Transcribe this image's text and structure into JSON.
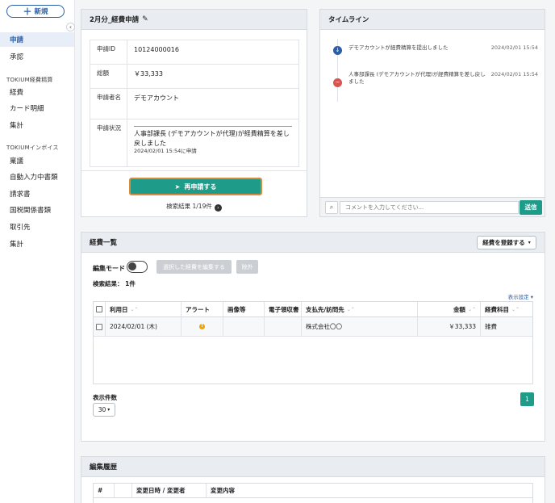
{
  "sidebar": {
    "new_button": "新規",
    "items_top": [
      {
        "label": "申請",
        "active": true
      },
      {
        "label": "承認",
        "active": false
      }
    ],
    "section_expense": "TOKIUM経費精算",
    "items_expense": [
      {
        "label": "経費"
      },
      {
        "label": "カード明細"
      },
      {
        "label": "集計"
      }
    ],
    "section_invoice": "TOKIUMインボイス",
    "items_invoice": [
      {
        "label": "稟議"
      },
      {
        "label": "自動入力中書類"
      },
      {
        "label": "請求書"
      },
      {
        "label": "国税関係書類"
      },
      {
        "label": "取引先"
      },
      {
        "label": "集計"
      }
    ]
  },
  "request": {
    "title": "2月分_経費申請",
    "fields": [
      {
        "key": "申請ID",
        "value": "10124000016"
      },
      {
        "key": "総額",
        "value": "￥33,333"
      },
      {
        "key": "申請者名",
        "value": "デモアカウント"
      },
      {
        "key": "申請状況",
        "value": "人事部課長 (デモアカウントが代理)が経費精算を差し戻しました",
        "sub": "2024/02/01 15:54に申請"
      }
    ],
    "resubmit_label": "再申請する",
    "search_result": "検索結果 1/19件"
  },
  "timeline": {
    "title": "タイムライン",
    "events": [
      {
        "text": "デモアカウントが経費精算を提出しました",
        "time": "2024/02/01 15:54",
        "icon": "down-arrow-icon",
        "color": "#2a5fab"
      },
      {
        "text": "人事部課長 (デモアカウントが代理)が経費精算を差し戻しました",
        "time": "2024/02/01 15:54",
        "icon": "minus-icon",
        "color": "#d9534f"
      }
    ],
    "comment_placeholder": "コメントを入力してください...",
    "send_label": "送信"
  },
  "expenses": {
    "title": "経費一覧",
    "register_label": "経費を登録する",
    "edit_mode_label": "編集モード",
    "edit_selected_label": "選択した経費を編集する",
    "exclude_label": "除外",
    "count_label": "検索結果： 1件",
    "display_settings": "表示設定",
    "columns": [
      "利用日",
      "アラート",
      "画像等",
      "電子領収書",
      "支払先/訪問先",
      "金額",
      "経費科目"
    ],
    "rows": [
      {
        "date": "2024/02/01 (木)",
        "alert": "!",
        "image": "",
        "ereceipt": "",
        "payee": "株式会社〇〇",
        "amount": "￥33,333",
        "category": "雑費"
      }
    ],
    "per_page_label": "表示件数",
    "per_page_value": "30",
    "page": "1"
  },
  "history": {
    "title": "編集履歴",
    "columns": [
      "#",
      "",
      "変更日時 / 変更者",
      "変更内容"
    ]
  }
}
